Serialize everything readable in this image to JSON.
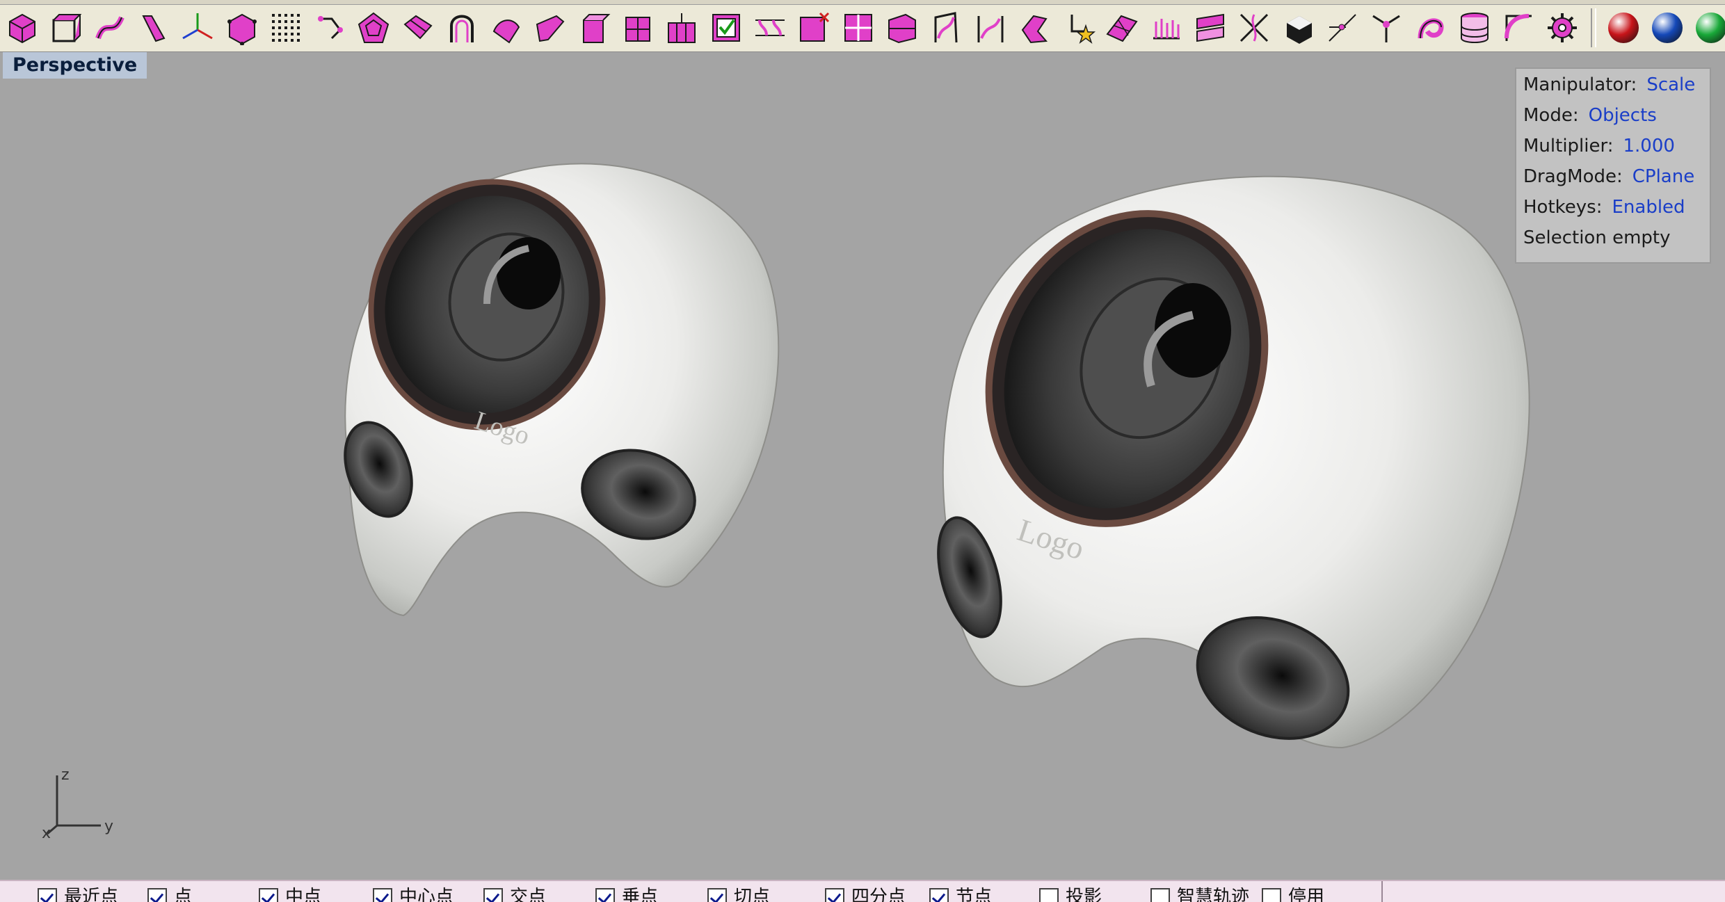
{
  "toolbar": {
    "tools": [
      {
        "icon": "box-wireframe-icon"
      },
      {
        "icon": "box-edge-icon"
      },
      {
        "icon": "twist-icon"
      },
      {
        "icon": "bend-icon"
      },
      {
        "icon": "gumball-axes-icon"
      },
      {
        "icon": "cage-box-icon"
      },
      {
        "icon": "point-grid-icon"
      },
      {
        "icon": "rotate-points-icon"
      },
      {
        "icon": "polyhedron-icon"
      },
      {
        "icon": "unroll-surface-icon"
      },
      {
        "icon": "arch-curve-icon"
      },
      {
        "icon": "flow-along-icon"
      },
      {
        "icon": "fold-plane-icon"
      },
      {
        "icon": "extrude-plane-icon"
      },
      {
        "icon": "grid-plane-icon"
      },
      {
        "icon": "column-grid-icon"
      },
      {
        "icon": "check-grid-icon"
      },
      {
        "icon": "copy-array-icon"
      },
      {
        "icon": "delete-grid-icon"
      },
      {
        "icon": "quad-grid-icon"
      },
      {
        "icon": "stack-grid-icon"
      },
      {
        "icon": "profile-curve-icon"
      },
      {
        "icon": "split-profile-icon"
      },
      {
        "icon": "sweep-shape-icon"
      },
      {
        "icon": "star-transform-icon"
      },
      {
        "icon": "patch-surface-icon"
      },
      {
        "icon": "comb-curve-icon"
      },
      {
        "icon": "contour-stack-icon"
      },
      {
        "icon": "cross-curves-icon"
      },
      {
        "icon": "solid-cube-icon"
      },
      {
        "icon": "intersect-lines-icon"
      },
      {
        "icon": "branch-curve-icon"
      },
      {
        "icon": "blend-curve-icon"
      },
      {
        "icon": "cylinder-rings-icon"
      },
      {
        "icon": "fillet-corner-icon"
      },
      {
        "icon": "gear-settings-icon"
      }
    ],
    "materials": [
      {
        "icon": "red-sphere-icon",
        "color": "#c8141a"
      },
      {
        "icon": "blue-sphere-icon",
        "color": "#1448b8"
      },
      {
        "icon": "green-render-icon",
        "color": "#18a838"
      }
    ]
  },
  "viewport": {
    "title": "Perspective",
    "logo_text": "Logo",
    "axis_labels": {
      "z": "z",
      "y": "y",
      "x": "x"
    }
  },
  "hud": [
    {
      "key": "Manipulator:",
      "value": "Scale"
    },
    {
      "key": "Mode:",
      "value": "Objects"
    },
    {
      "key": "Multiplier:",
      "value": "1.000"
    },
    {
      "key": "DragMode:",
      "value": "CPlane"
    },
    {
      "key": "Hotkeys:",
      "value": "Enabled"
    },
    {
      "key": "Selection empty",
      "value": ""
    }
  ],
  "osnaps": [
    {
      "label": "最近点",
      "checked": true
    },
    {
      "label": "点",
      "checked": true
    },
    {
      "label": "中点",
      "checked": true
    },
    {
      "label": "中心点",
      "checked": true
    },
    {
      "label": "交点",
      "checked": true
    },
    {
      "label": "垂点",
      "checked": true
    },
    {
      "label": "切点",
      "checked": true
    },
    {
      "label": "四分点",
      "checked": true
    },
    {
      "label": "节点",
      "checked": true
    },
    {
      "label": "投影",
      "checked": false
    },
    {
      "label": "智慧轨迹",
      "checked": false
    },
    {
      "label": "停用",
      "checked": false
    }
  ]
}
